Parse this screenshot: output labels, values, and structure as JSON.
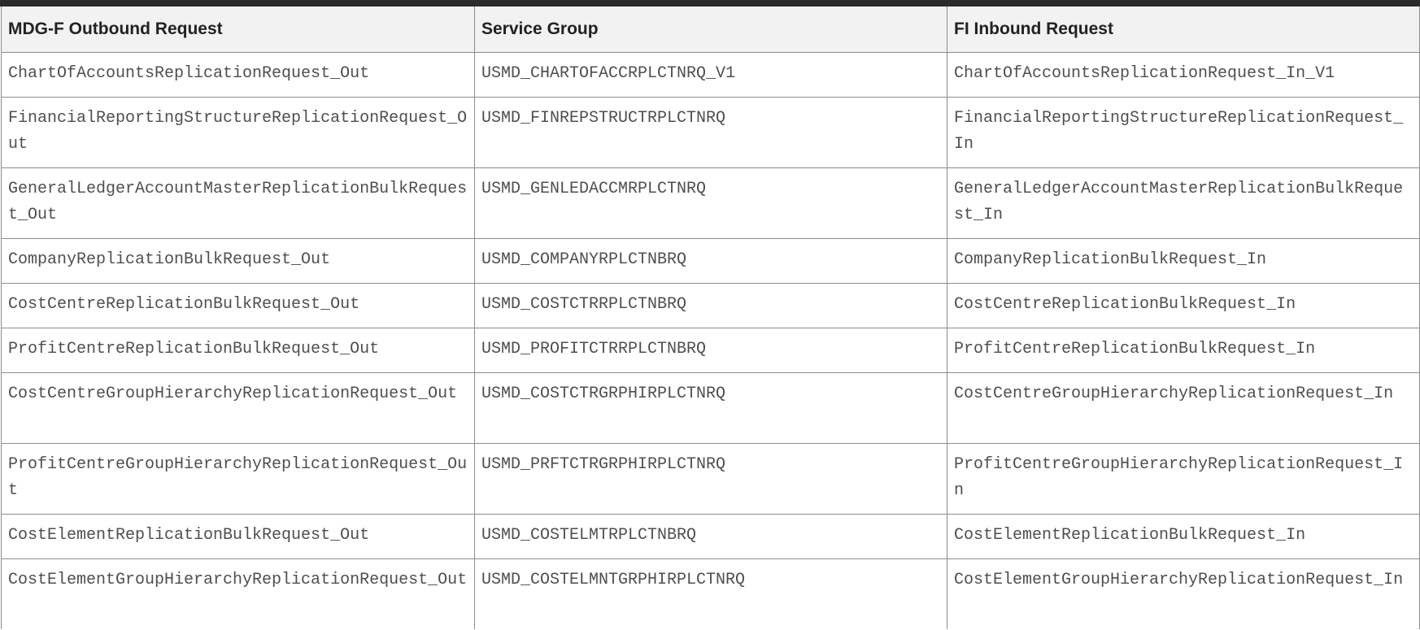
{
  "table": {
    "headers": [
      "MDG-F Outbound Request",
      "Service Group",
      "FI Inbound Request"
    ],
    "rows": [
      [
        "ChartOfAccountsReplicationRequest_Out",
        "USMD_CHARTOFACCRPLCTNRQ_V1",
        "ChartOfAccountsReplicationRequest_In_V1"
      ],
      [
        "FinancialReportingStructureReplicationRequest_Out",
        "USMD_FINREPSTRUCTRPLCTNRQ",
        "FinancialReportingStructureReplicationRequest_In"
      ],
      [
        "GeneralLedgerAccountMasterReplicationBulkRequest_Out",
        "USMD_GENLEDACCMRPLCTNRQ",
        "GeneralLedgerAccountMasterReplicationBulkRequest_In"
      ],
      [
        "CompanyReplicationBulkRequest_Out",
        "USMD_COMPANYRPLCTNBRQ",
        "CompanyReplicationBulkRequest_In"
      ],
      [
        "CostCentreReplicationBulkRequest_Out",
        "USMD_COSTCTRRPLCTNBRQ",
        "CostCentreReplicationBulkRequest_In"
      ],
      [
        "ProfitCentreReplicationBulkRequest_Out",
        "USMD_PROFITCTRRPLCTNBRQ",
        "ProfitCentreReplicationBulkRequest_In"
      ],
      [
        "CostCentreGroupHierarchyReplicationRequest_Out",
        "USMD_COSTCTRGRPHIRPLCTNRQ",
        "CostCentreGroupHierarchyReplicationRequest_In"
      ],
      [
        "ProfitCentreGroupHierarchyReplicationRequest_Out",
        "USMD_PRFTCTRGRPHIRPLCTNRQ",
        "ProfitCentreGroupHierarchyReplicationRequest_In"
      ],
      [
        "CostElementReplicationBulkRequest_Out",
        "USMD_COSTELMTRPLCTNBRQ",
        "CostElementReplicationBulkRequest_In"
      ],
      [
        "CostElementGroupHierarchyReplicationRequest_Out",
        "USMD_COSTELMNTGRPHIRPLCTNRQ",
        "CostElementGroupHierarchyReplicationRequest_In"
      ]
    ]
  }
}
